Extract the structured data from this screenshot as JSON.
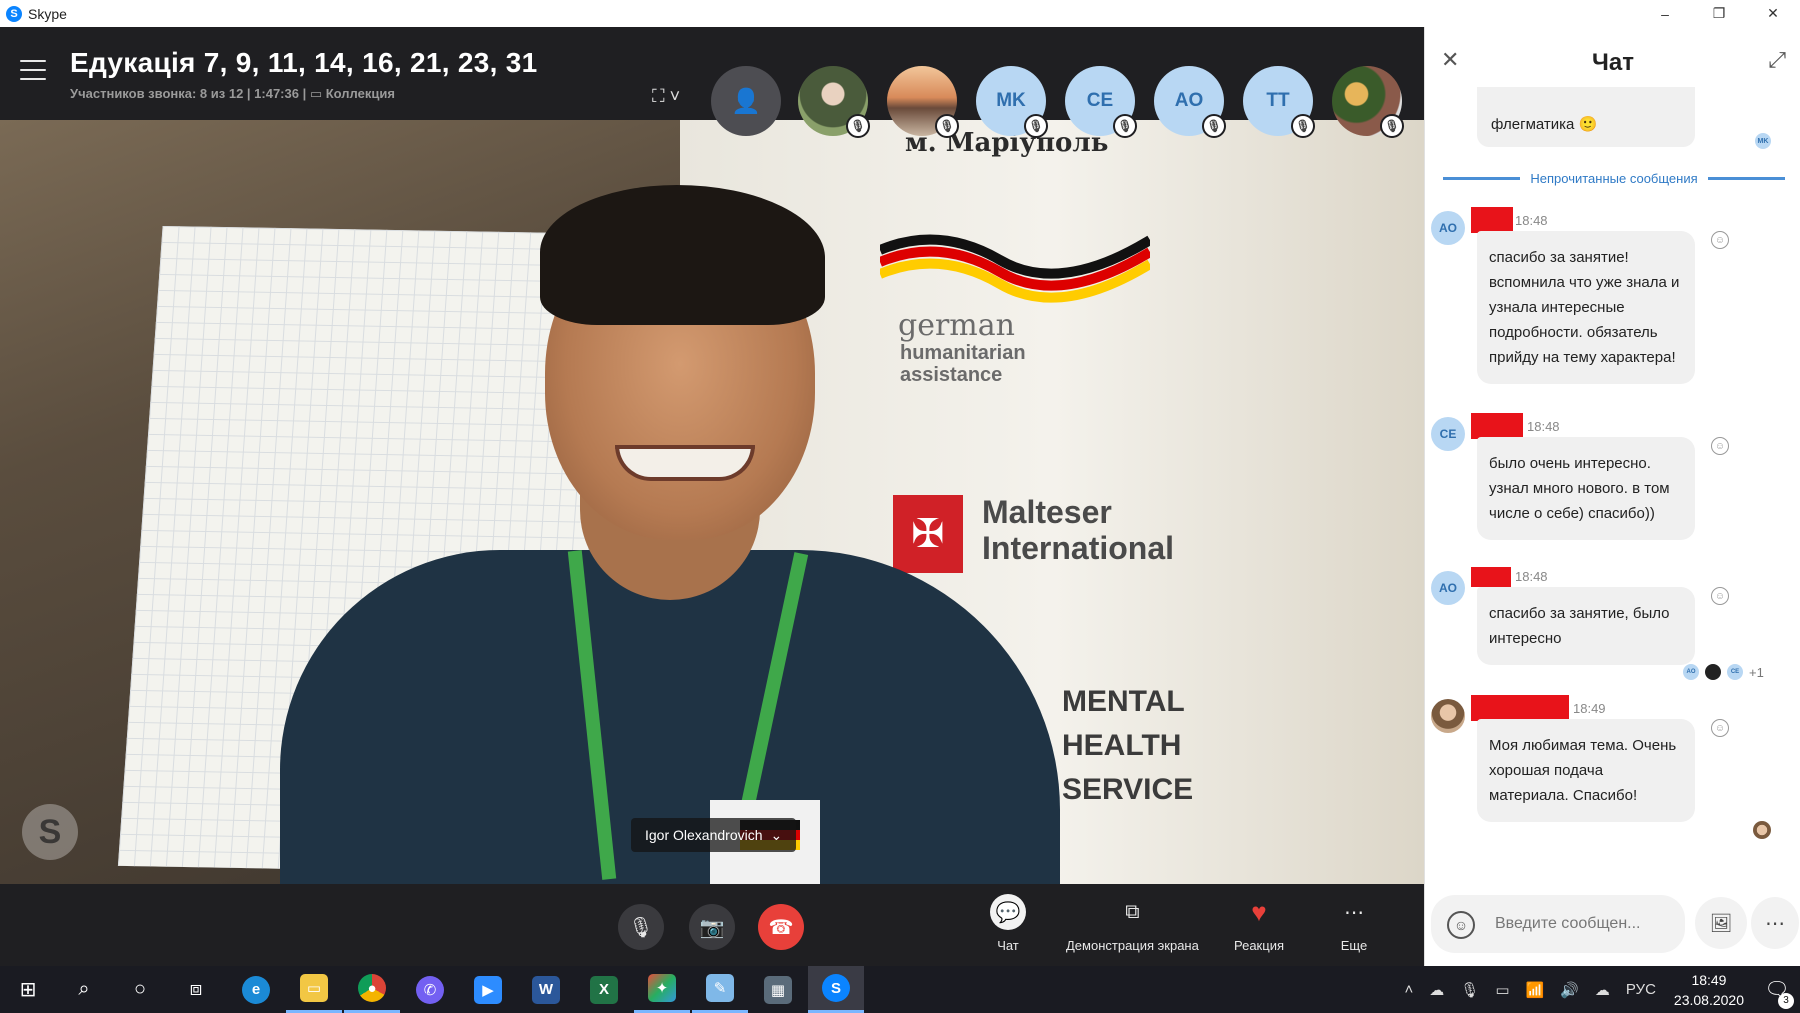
{
  "window": {
    "app_title": "Skype",
    "controls": {
      "minimize": "–",
      "restore": "❐",
      "close": "✕"
    }
  },
  "call": {
    "title": "Едукація 7, 9, 11, 14, 16, 21, 23, 31",
    "subtitle": "Участников звонка: 8 из 12 | 1:47:36 | ▭ Коллекция",
    "participants": [
      {
        "initials": "",
        "muted": true
      },
      {
        "initials": "",
        "muted": true
      },
      {
        "initials": "MK",
        "muted": true
      },
      {
        "initials": "CE",
        "muted": true
      },
      {
        "initials": "AO",
        "muted": true
      },
      {
        "initials": "TT",
        "muted": true
      },
      {
        "initials": "",
        "muted": true
      }
    ],
    "speaker_name": "Igor Olexandrovich",
    "video_banner": {
      "city": "м. Маріуполь",
      "org1_line1": "german",
      "org1_line2": "humanitarian",
      "org1_line3": "assistance",
      "org2_line1": "Malteser",
      "org2_line2": "International",
      "org3_line1": "MENTAL",
      "org3_line2": "HEALTH",
      "org3_line3": "SERVICE"
    }
  },
  "controls": {
    "chat_label": "Чат",
    "share_label": "Демонстрация экрана",
    "reaction_label": "Реакция",
    "more_label": "Еще"
  },
  "chat": {
    "title": "Чат",
    "prev_message": "флегматика 🙂",
    "prev_read_initials": "MK",
    "unread_label": "Непрочитанные сообщения",
    "messages": [
      {
        "avatar": "AO",
        "time": "18:48",
        "text": "спасибо за занятие! вспомнила что уже знала и узнала интересные подробности. обязатель прийду на тему характера!"
      },
      {
        "avatar": "CE",
        "time": "18:48",
        "text": " было очень интересно. узнал много нового. в том числе о себе) спасибо))"
      },
      {
        "avatar": "AO",
        "time": "18:48",
        "text": "спасибо за занятие, было интересно"
      },
      {
        "avatar": "",
        "time": "18:49",
        "text": "Моя любимая тема. Очень хорошая подача материала.  Спасибо!"
      }
    ],
    "seen_by": [
      "AO",
      "",
      "CE"
    ],
    "seen_more": "+1",
    "composer_placeholder": "Введите сообщен..."
  },
  "taskbar": {
    "lang": "РУС",
    "time": "18:49",
    "date": "23.08.2020",
    "notifications": "3",
    "apps": [
      {
        "name": "word",
        "glyph": "W",
        "color": "#2b579a"
      },
      {
        "name": "excel",
        "glyph": "X",
        "color": "#217346"
      },
      {
        "name": "skype",
        "glyph": "S",
        "color": "#0a84ff"
      }
    ]
  }
}
